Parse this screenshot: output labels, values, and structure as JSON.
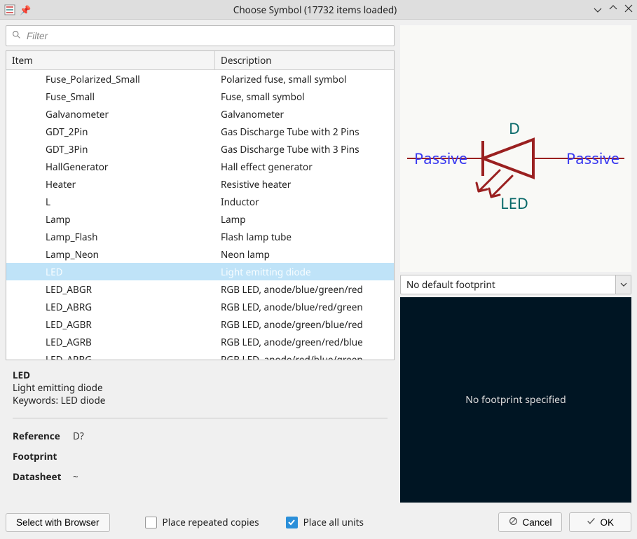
{
  "window": {
    "title": "Choose Symbol (17732 items loaded)"
  },
  "filter": {
    "placeholder": "Filter"
  },
  "table": {
    "headers": {
      "item": "Item",
      "description": "Description"
    },
    "rows": [
      {
        "item": "Fuse_Polarized_Small",
        "desc": "Polarized fuse, small symbol",
        "selected": false
      },
      {
        "item": "Fuse_Small",
        "desc": "Fuse, small symbol",
        "selected": false
      },
      {
        "item": "Galvanometer",
        "desc": "Galvanometer",
        "selected": false
      },
      {
        "item": "GDT_2Pin",
        "desc": "Gas Discharge Tube with 2 Pins",
        "selected": false
      },
      {
        "item": "GDT_3Pin",
        "desc": "Gas Discharge Tube with 3 Pins",
        "selected": false
      },
      {
        "item": "HallGenerator",
        "desc": "Hall effect generator",
        "selected": false
      },
      {
        "item": "Heater",
        "desc": "Resistive heater",
        "selected": false
      },
      {
        "item": "L",
        "desc": "Inductor",
        "selected": false
      },
      {
        "item": "Lamp",
        "desc": "Lamp",
        "selected": false
      },
      {
        "item": "Lamp_Flash",
        "desc": "Flash lamp tube",
        "selected": false
      },
      {
        "item": "Lamp_Neon",
        "desc": "Neon lamp",
        "selected": false
      },
      {
        "item": "LED",
        "desc": "Light emitting diode",
        "selected": true
      },
      {
        "item": "LED_ABGR",
        "desc": "RGB LED, anode/blue/green/red",
        "selected": false
      },
      {
        "item": "LED_ABRG",
        "desc": "RGB LED, anode/blue/red/green",
        "selected": false
      },
      {
        "item": "LED_AGBR",
        "desc": "RGB LED, anode/green/blue/red",
        "selected": false
      },
      {
        "item": "LED_AGRB",
        "desc": "RGB LED, anode/green/red/blue",
        "selected": false
      },
      {
        "item": "LED_ARBG",
        "desc": "RGB LED, anode/red/blue/green",
        "selected": false
      }
    ]
  },
  "details": {
    "name": "LED",
    "desc": "Light emitting diode",
    "keywords_label": "Keywords:",
    "keywords": "LED diode",
    "reference_label": "Reference",
    "reference": "D?",
    "footprint_label": "Footprint",
    "footprint": "",
    "datasheet_label": "Datasheet",
    "datasheet": "~"
  },
  "preview": {
    "refdes": "D",
    "value": "LED",
    "pin_left": "Passive",
    "pin_right": "Passive"
  },
  "fp_select": {
    "text": "No default footprint"
  },
  "fp_view": {
    "text": "No footprint specified"
  },
  "actions": {
    "select_browser": "Select with Browser",
    "place_repeated": "Place repeated copies",
    "place_all_units": "Place all units",
    "cancel": "Cancel",
    "ok": "OK"
  }
}
